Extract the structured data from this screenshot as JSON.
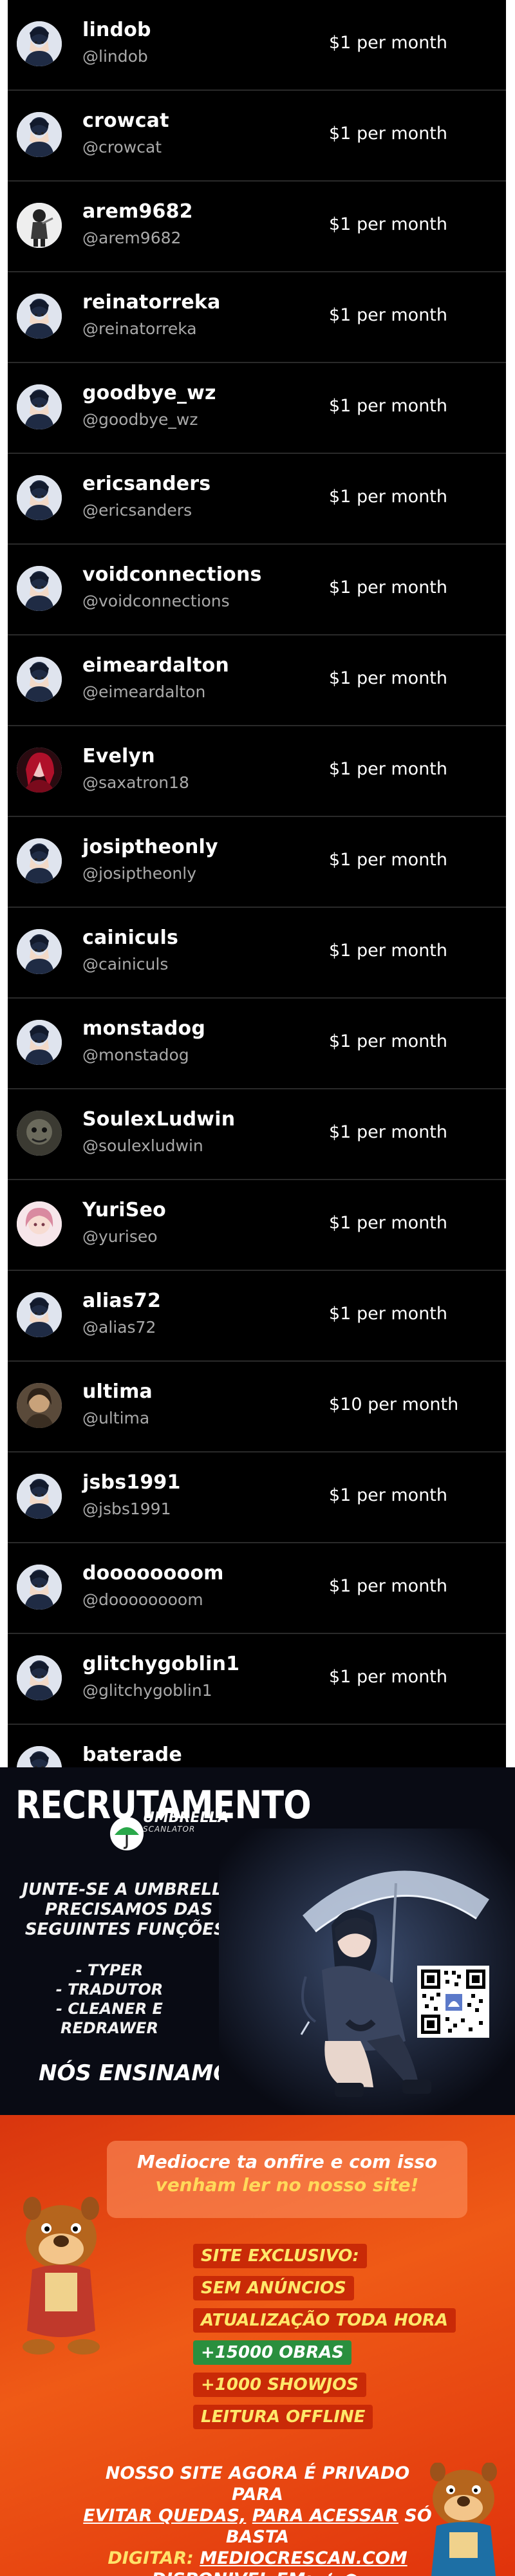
{
  "subscribers": [
    {
      "name": "lindob",
      "handle": "@lindob",
      "price": "$1 per month",
      "avatar": "default"
    },
    {
      "name": "crowcat",
      "handle": "@crowcat",
      "price": "$1 per month",
      "avatar": "default"
    },
    {
      "name": "arem9682",
      "handle": "@arem9682",
      "price": "$1 per month",
      "avatar": "character"
    },
    {
      "name": "reinatorreka",
      "handle": "@reinatorreka",
      "price": "$1 per month",
      "avatar": "default"
    },
    {
      "name": "goodbye_wz",
      "handle": "@goodbye_wz",
      "price": "$1 per month",
      "avatar": "default"
    },
    {
      "name": "ericsanders",
      "handle": "@ericsanders",
      "price": "$1 per month",
      "avatar": "default"
    },
    {
      "name": "voidconnections",
      "handle": "@voidconnections",
      "price": "$1 per month",
      "avatar": "default"
    },
    {
      "name": "eimeardalton",
      "handle": "@eimeardalton",
      "price": "$1 per month",
      "avatar": "default"
    },
    {
      "name": "Evelyn",
      "handle": "@saxatron18",
      "price": "$1 per month",
      "avatar": "red"
    },
    {
      "name": "josiptheonly",
      "handle": "@josiptheonly",
      "price": "$1 per month",
      "avatar": "default"
    },
    {
      "name": "cainiculs",
      "handle": "@cainiculs",
      "price": "$1 per month",
      "avatar": "default"
    },
    {
      "name": "monstadog",
      "handle": "@monstadog",
      "price": "$1 per month",
      "avatar": "default"
    },
    {
      "name": "SoulexLudwin",
      "handle": "@soulexludwin",
      "price": "$1 per month",
      "avatar": "dark"
    },
    {
      "name": "YuriSeo",
      "handle": "@yuriseo",
      "price": "$1 per month",
      "avatar": "pink"
    },
    {
      "name": "alias72",
      "handle": "@alias72",
      "price": "$1 per month",
      "avatar": "default"
    },
    {
      "name": "ultima",
      "handle": "@ultima",
      "price": "$10 per month",
      "avatar": "brown"
    },
    {
      "name": "jsbs1991",
      "handle": "@jsbs1991",
      "price": "$1 per month",
      "avatar": "default"
    },
    {
      "name": "doooooooom",
      "handle": "@doooooooom",
      "price": "$1 per month",
      "avatar": "default"
    },
    {
      "name": "glitchygoblin1",
      "handle": "@glitchygoblin1",
      "price": "$1 per month",
      "avatar": "default"
    },
    {
      "name": "baterade",
      "handle": "",
      "price": "",
      "avatar": "default"
    }
  ],
  "recruitment": {
    "title": "RECRUTAMENTO",
    "brand": "UMBRELLA",
    "brand_sub": "SCANLATOR",
    "intro": "JUNTE-SE A UMBRELLA PRECISAMOS DAS SEGUINTES FUNÇÕES:",
    "roles": [
      "- TYPER",
      "- TRADUTOR",
      "- CLEANER E REDRAWER"
    ],
    "footer": "NÓS ENSINAMOS!"
  },
  "promo": {
    "headline_line1": "Mediocre ta onfire e com isso",
    "headline_line2": "venham ler no nosso site!",
    "features": [
      {
        "text": "SITE EXCLUSIVO:",
        "style": "red"
      },
      {
        "text": "SEM ANÚNCIOS",
        "style": "red"
      },
      {
        "text": "ATUALIZAÇÃO TODA HORA",
        "style": "red"
      },
      {
        "text": "+15000 OBRAS",
        "style": "green"
      },
      {
        "text": "+1000 SHOWJOS",
        "style": "red"
      },
      {
        "text": "LEITURA OFFLINE",
        "style": "red"
      }
    ],
    "private_line1": "NOSSO SITE AGORA É PRIVADO PARA",
    "private_line2_a": "EVITAR QUEDAS,",
    "private_line2_b": "PARA ACESSAR",
    "private_line2_c": "SÓ BASTA",
    "digitar_label": "DIGITAR:",
    "site": "MEDIOCRESCAN.COM",
    "available": "DISPONIVEL EM:",
    "colors": {
      "orange": "#ef5a16",
      "yellow": "#ffe36a",
      "green": "#2a8f3e"
    }
  }
}
